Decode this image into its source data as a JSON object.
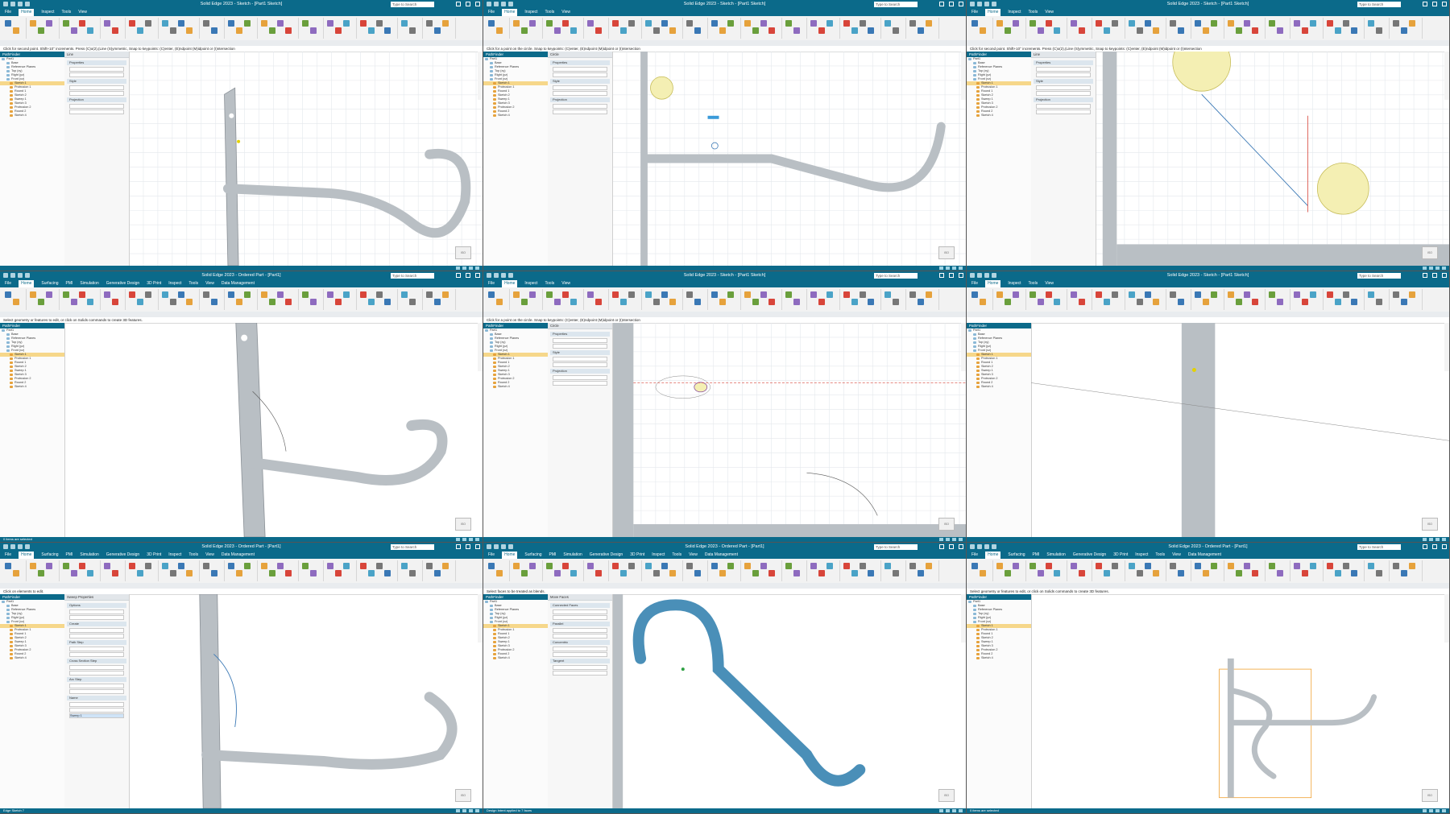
{
  "colors": {
    "title_bar": "#0b6a8a",
    "model_body": "#b9bfc4",
    "model_blue": "#4a8fb8",
    "highlight_circle": "#f4efb3",
    "selection_orange": "#f6d78a",
    "sketch_line": "#3a78b5"
  },
  "panes": [
    {
      "title": "Solid Edge 2023 - Sketch - [Part1 Sketch]",
      "search_placeholder": "Type to Search",
      "menus": [
        "File",
        "Home",
        "Inspect",
        "Tools",
        "View"
      ],
      "active_menu": "Home",
      "prompt": "Click for second point. Shift+10° increments. Press (C)o(2),(Line (S)ymmetric, Snap to keypoints: (C)enter, (E)ndpoint (M)idpoint or (I)ntersection",
      "tree_title": "PathFinder",
      "prop_title": "Line",
      "viewport_label": "",
      "status": ""
    },
    {
      "title": "Solid Edge 2023 - Sketch - [Part1 Sketch]",
      "search_placeholder": "Type to Search",
      "menus": [
        "File",
        "Home",
        "Inspect",
        "Tools",
        "View"
      ],
      "active_menu": "Home",
      "prompt": "Click for a point on the circle. Snap to keypoints: (C)enter, (E)ndpoint (M)idpoint or (I)ntersection",
      "tree_title": "PathFinder",
      "prop_title": "Circle",
      "viewport_label": "",
      "status": ""
    },
    {
      "title": "Solid Edge 2023 - Sketch - [Part1 Sketch]",
      "search_placeholder": "Type to Search",
      "menus": [
        "File",
        "Home",
        "Inspect",
        "Tools",
        "View"
      ],
      "active_menu": "Home",
      "prompt": "Click for second point. Shift+10° increments. Press (C)o(2),(Line (S)ymmetric, Snap to keypoints: (C)enter, (E)ndpoint (M)idpoint or (I)ntersection",
      "tree_title": "PathFinder",
      "prop_title": "Line",
      "viewport_label": "",
      "status": ""
    },
    {
      "title": "Solid Edge 2023 - Ordered Part - [Part1]",
      "search_placeholder": "Type to Search",
      "menus": [
        "File",
        "Home",
        "Surfacing",
        "PMI",
        "Simulation",
        "Generative Design",
        "3D Print",
        "Inspect",
        "Tools",
        "View",
        "Data Management"
      ],
      "active_menu": "Home",
      "prompt": "Select geometry or features to edit, or click on Solids commands to create 3D features.",
      "tree_title": "PathFinder",
      "prop_title": "",
      "viewport_label": "",
      "status": "0 items are selected"
    },
    {
      "title": "Solid Edge 2023 - Sketch - [Part1 Sketch]",
      "search_placeholder": "Type to Search",
      "menus": [
        "File",
        "Home",
        "Inspect",
        "Tools",
        "View"
      ],
      "active_menu": "Home",
      "prompt": "Click for a point on the circle. Snap to keypoints: (C)enter, (E)ndpoint (M)idpoint or (I)ntersection",
      "tree_title": "PathFinder",
      "prop_title": "Circle",
      "viewport_label": "",
      "status": ""
    },
    {
      "title": "Solid Edge 2023 - Sketch - [Part1 Sketch]",
      "search_placeholder": "Type to Search",
      "menus": [
        "File",
        "Home",
        "Inspect",
        "Tools",
        "View"
      ],
      "active_menu": "Home",
      "prompt": "",
      "tree_title": "PathFinder",
      "prop_title": "",
      "viewport_label": "",
      "status": ""
    },
    {
      "title": "Solid Edge 2023 - Ordered Part - [Part1]",
      "search_placeholder": "Type to Search",
      "menus": [
        "File",
        "Home",
        "Surfacing",
        "PMI",
        "Simulation",
        "Generative Design",
        "3D Print",
        "Inspect",
        "Tools",
        "View",
        "Data Management"
      ],
      "active_menu": "Home",
      "prompt": "Click on elements to edit.",
      "tree_title": "PathFinder",
      "prop_title": "Sweep Properties",
      "viewport_label": "",
      "status": "Edge Sketch 7"
    },
    {
      "title": "Solid Edge 2023 - Ordered Part - [Part1]",
      "search_placeholder": "Type to Search",
      "menus": [
        "File",
        "Home",
        "Surfacing",
        "PMI",
        "Simulation",
        "Generative Design",
        "3D Print",
        "Inspect",
        "Tools",
        "View",
        "Data Management"
      ],
      "active_menu": "Home",
      "prompt": "Select faces to be treated as blends.",
      "tree_title": "PathFinder",
      "prop_title": "Move Faces",
      "viewport_label": "",
      "status": "Design Intent applied to 7 faces"
    },
    {
      "title": "Solid Edge 2023 - Ordered Part - [Part1]",
      "search_placeholder": "Type to Search",
      "menus": [
        "File",
        "Home",
        "Surfacing",
        "PMI",
        "Simulation",
        "Generative Design",
        "3D Print",
        "Inspect",
        "Tools",
        "View",
        "Data Management"
      ],
      "active_menu": "Home",
      "prompt": "Select geometry or features to edit, or click on Solids commands to create 3D features.",
      "tree_title": "PathFinder",
      "prop_title": "",
      "viewport_label": "",
      "status": "0 items are selected"
    }
  ],
  "tree_items": [
    "Part1",
    "Base",
    "Reference Planes",
    "Top (xy)",
    "Right (yz)",
    "Front (xz)",
    "Sketch 1",
    "Protrusion 1",
    "Round 1",
    "Sketch 2",
    "Sweep 1",
    "Sketch 3",
    "Protrusion 2",
    "Round 2",
    "Sketch 4"
  ],
  "prop_sections": [
    "Properties",
    "Style",
    "Projection"
  ],
  "sweep_options": [
    "Options",
    "Create",
    "Path Step",
    "Cross Section Step",
    "Arc Step",
    "Name"
  ],
  "sweep_name_value": "Sweep 1",
  "move_faces_items": [
    "Connected Faces",
    "Parallel",
    "Concentric",
    "Tangent"
  ]
}
